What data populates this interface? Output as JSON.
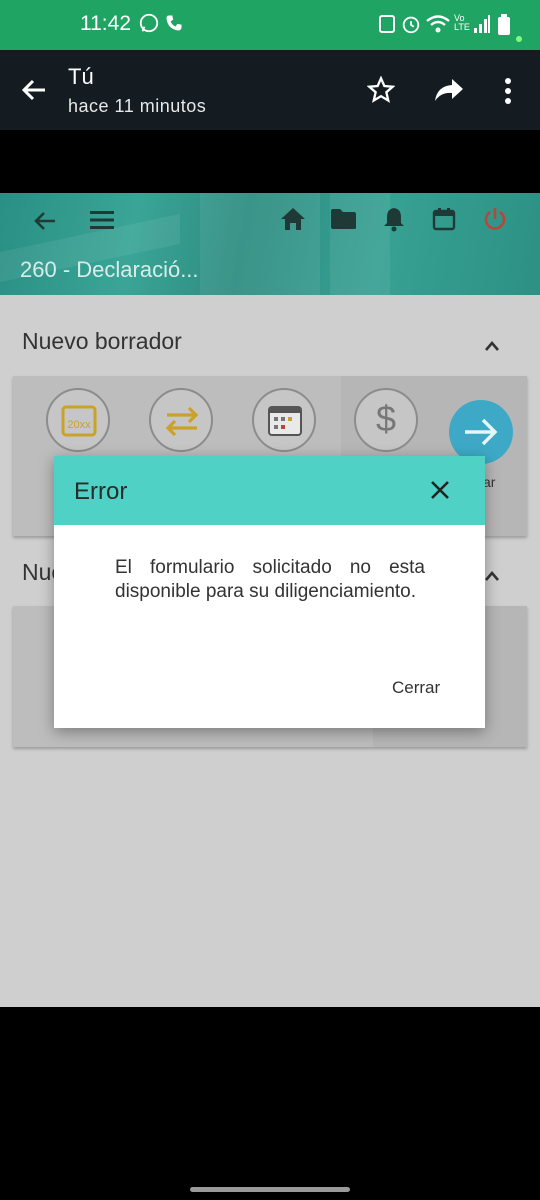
{
  "status_bar": {
    "time": "11:42"
  },
  "viewer": {
    "title": "Tú",
    "subtitle": "hace 11 minutos"
  },
  "app": {
    "page_title": "260 - Declaració...",
    "section1_title": "Nuevo borrador",
    "section2_title": "Nue",
    "calendar_badge": "20xx",
    "partial_label": "ar"
  },
  "dialog": {
    "title": "Error",
    "message": "El formulario solicitado no esta disponible para su diligenciamiento.",
    "close_label": "Cerrar"
  },
  "colors": {
    "status": "#1fa463",
    "dialog_header": "#4fd1c5",
    "accent_teal": "#3aa596",
    "power_red": "#c0392b"
  }
}
